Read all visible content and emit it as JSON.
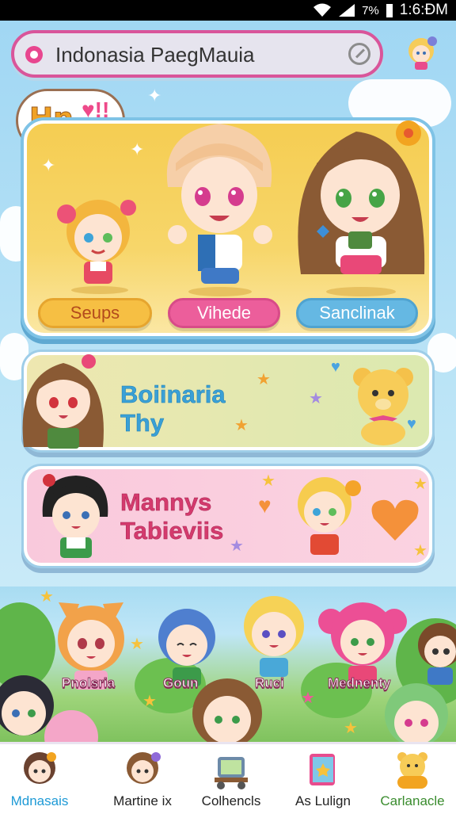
{
  "status_bar": {
    "battery": "7%",
    "time": "1:6:ÐM"
  },
  "search": {
    "value": "Indonasia PaegMauia"
  },
  "hero": {
    "bubble_text": "Hn",
    "buttons": [
      "Seups",
      "Vihede",
      "Sanclinak"
    ]
  },
  "banners": [
    {
      "title_line1": "Boiinaria",
      "title_line2": "Thy"
    },
    {
      "title_line1": "Mannys",
      "title_line2": "Tabieviis"
    }
  ],
  "characters": [
    "Pnolsria",
    "Goun",
    "Ruci",
    "Mednenty"
  ],
  "nav": {
    "items": [
      "Mdnasais",
      "Martine ix",
      "Colhencls",
      "As Lulign",
      "Carlanacle"
    ],
    "active_index": 0
  },
  "colors": {
    "accent_pink": "#e8468f",
    "accent_blue": "#1e9ad6",
    "card_yellow": "#f5cd52"
  }
}
